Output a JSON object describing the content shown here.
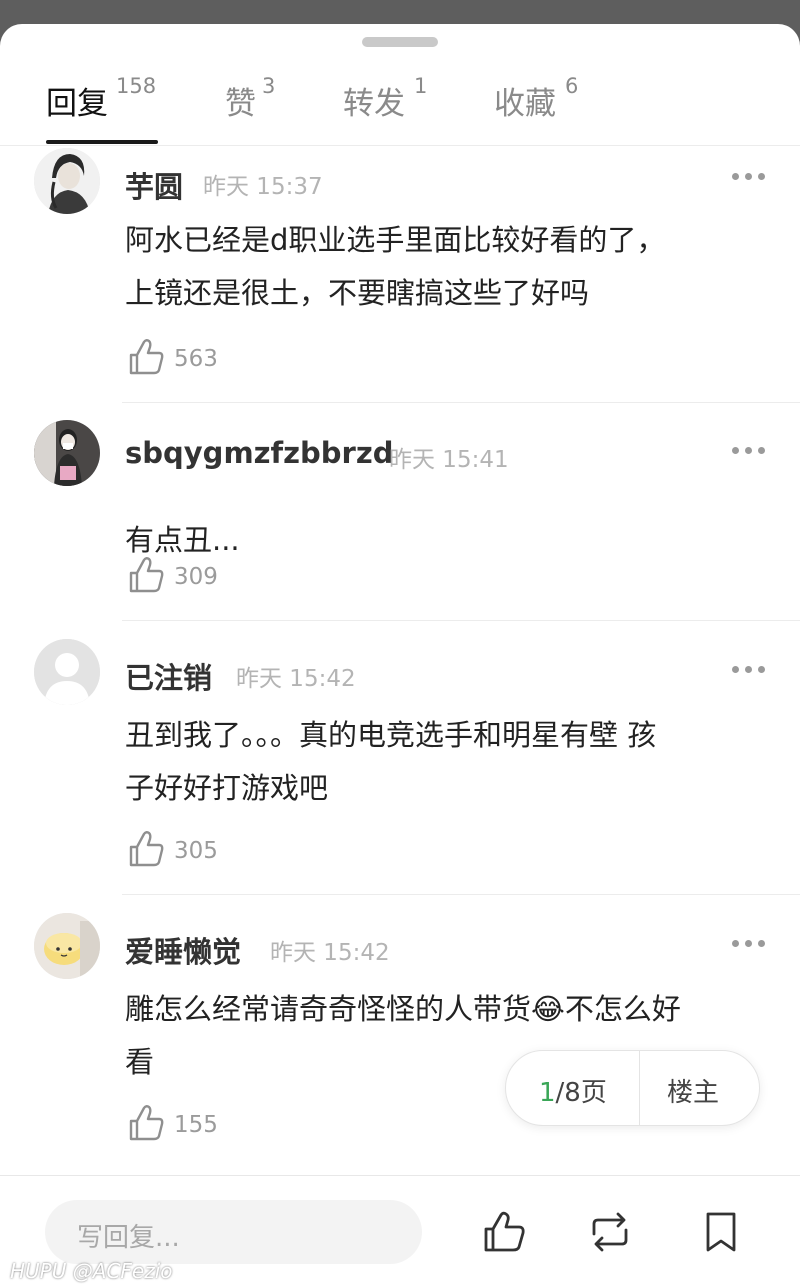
{
  "tabs": [
    {
      "label": "回复",
      "count": "158"
    },
    {
      "label": "赞",
      "count": "3"
    },
    {
      "label": "转发",
      "count": "1"
    },
    {
      "label": "收藏",
      "count": "6"
    }
  ],
  "comments": [
    {
      "username": "芋圆",
      "time": "昨天 15:37",
      "text_lines": [
        "阿水已经是d职业选手里面比较好看的了，",
        "上镜还是很土，不要瞎搞这些了好吗"
      ],
      "likes": "563"
    },
    {
      "username": "sbqygmzfzbbrzd",
      "time": "昨天 15:41",
      "text_lines": [
        "有点丑..."
      ],
      "likes": "309"
    },
    {
      "username": "已注销",
      "time": "昨天 15:42",
      "text_lines": [
        "丑到我了。。。真的电竞选手和明星有壁 孩",
        "子好好打游戏吧"
      ],
      "likes": "305"
    },
    {
      "username": "爱睡懒觉",
      "time": "昨天 15:42",
      "text_lines": [
        "雕怎么经常请奇奇怪怪的人带货😂不怎么好",
        "看"
      ],
      "likes": "155"
    }
  ],
  "pager": {
    "current": "1",
    "total_suffix": "/8页",
    "op_label": "楼主"
  },
  "bottom_bar": {
    "reply_placeholder": "写回复..."
  },
  "watermark": "HUPU @ACFezio",
  "colors": {
    "accent_green": "#3aa657",
    "text_primary": "#222222",
    "text_muted": "#b4b4b4",
    "backdrop": "#5e5e5e"
  }
}
